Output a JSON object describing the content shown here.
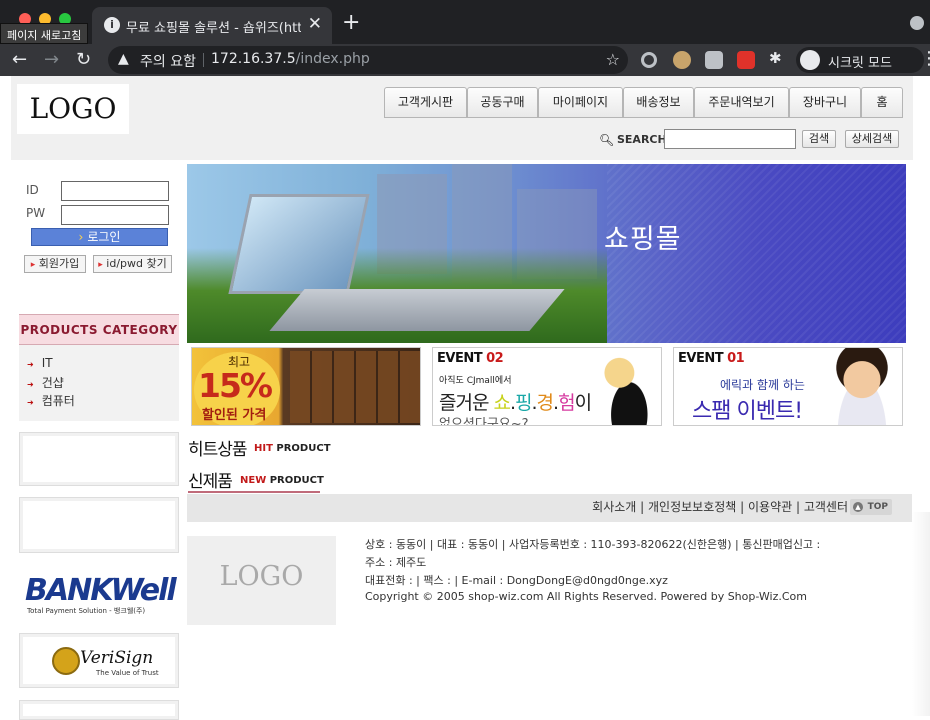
{
  "browser": {
    "tab_title": "무료 쇼핑몰 솔루션 - 숍위즈(http://",
    "tooltip": "페이지 새로고침",
    "security_label": "주의 요함",
    "url_host": "172.16.37.5",
    "url_path": "/index.php",
    "incognito_label": "시크릿 모드"
  },
  "header": {
    "logo": "LOGO",
    "menu": [
      "고객게시판",
      "공동구매",
      "마이페이지",
      "배송정보",
      "주문내역보기",
      "장바구니",
      "홈"
    ],
    "search_label": "SEARCH",
    "search_button": "검색",
    "detail_search_button": "상세검색"
  },
  "login": {
    "id_label": "ID",
    "pw_label": "PW",
    "login_button": "로그인",
    "join_button": "회원가입",
    "find_button": "id/pwd 찾기"
  },
  "category": {
    "title": "PRODUCTS CATEGORY",
    "items": [
      "IT",
      "건샵",
      "컴퓨터"
    ]
  },
  "side_banners": {
    "bankwell_title": "BANKWell",
    "bankwell_sub": "Total Payment Solution - 뱅크웰(주)",
    "verisign_title": "VeriSign",
    "verisign_sub": "The Value of Trust"
  },
  "main_banner": {
    "text": "쇼핑몰"
  },
  "events": {
    "e1": {
      "top": "최고",
      "pct": "15%",
      "bottom": "할인된 가격"
    },
    "e2": {
      "title": "EVENT ",
      "num": "02",
      "small": "아직도 CJmall에서",
      "big_pre": "즐거운 ",
      "c1": "쇼",
      ".": ".",
      "c2": "핑",
      "c3": "경",
      "c4": "험",
      "big_post": "이",
      "tail": "없으셨다구요~?"
    },
    "e3": {
      "title": "EVENT ",
      "num": "01",
      "small": "에릭과 함께 하는",
      "big": "스팸 이벤트!"
    }
  },
  "sections": {
    "hit_title": "히트상품",
    "hit_sub_red": "HIT",
    "hit_sub": " PRODUCT",
    "new_title": "신제품",
    "new_sub_red": "NEW",
    "new_sub": " PRODUCT"
  },
  "footer": {
    "links": "회사소개 | 개인정보보호정책 | 이용약관 | 고객센터",
    "top_label": "TOP",
    "logo": "LOGO",
    "line1": "상호 : 동동이 | 대표 : 동동이 | 사업자등록번호 : 110-393-820622(신한은행) | 통신판매업신고 :",
    "line2": "주소 : 제주도",
    "line3": "대표전화 : | 팩스 : | E-mail : DongDongE@d0ngd0nge.xyz",
    "line4": "Copyright © 2005 shop-wiz.com All Rights Reserved. Powered by Shop-Wiz.Com"
  },
  "colors": {
    "accent_red": "#c21a1a",
    "login_blue": "#5b82d8",
    "category_pink": "#f7dce1"
  }
}
